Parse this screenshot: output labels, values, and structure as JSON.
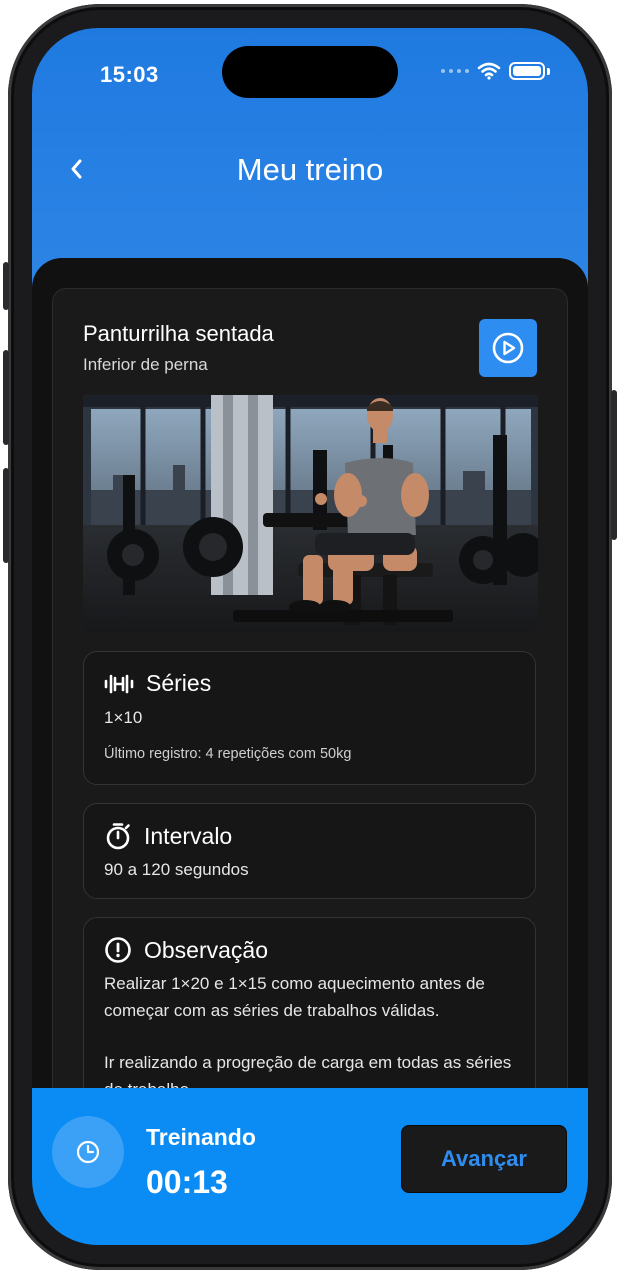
{
  "status": {
    "time": "15:03"
  },
  "header": {
    "title": "Meu treino"
  },
  "exercise": {
    "name": "Panturrilha sentada",
    "subtitle": "Inferior de perna"
  },
  "sets": {
    "title": "Séries",
    "value": "1×10",
    "last_record": "Último registro: 4 repetições com 50kg"
  },
  "interval": {
    "title": "Intervalo",
    "value": "90 a 120 segundos"
  },
  "observation": {
    "title": "Observação",
    "paragraph1": "Realizar 1×20 e 1×15 como aquecimento antes de começar com as séries de trabalhos válidas.",
    "paragraph2": "Ir realizando a progreção de carga em todas as séries de trabalho."
  },
  "footer": {
    "status_label": "Treinando",
    "timer": "00:13",
    "advance_label": "Avançar"
  },
  "icons": {
    "back": "chevron-left-icon",
    "play": "play-circle-icon",
    "sets": "dumbbell-icon",
    "interval": "stopwatch-icon",
    "observation": "alert-circle-icon",
    "timer": "clock-icon"
  },
  "colors": {
    "header_blue": "#1f7ae0",
    "accent": "#2e8df0",
    "footer_blue": "#0b8cf5",
    "background": "#111112"
  }
}
